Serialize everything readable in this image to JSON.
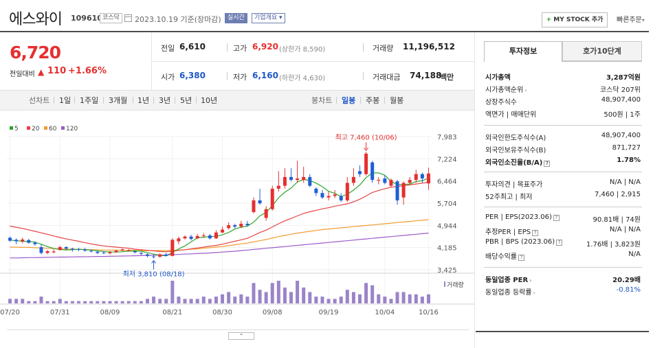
{
  "header": {
    "name": "에스와이",
    "code": "109610",
    "market": "코스닥",
    "date": "2023.10.19 기준(장마감)",
    "realtime_label": "실시간",
    "company_label": "기업개요",
    "mystock_label": "MY STOCK 추가",
    "quick_label": "빠른주문"
  },
  "price": {
    "current": "6,720",
    "diff_label": "전일대비",
    "diff_symbol": "▲",
    "diff_value": "110",
    "diff_rate": "+1.66%"
  },
  "quote": {
    "prev_close_label": "전일",
    "prev_close": "6,610",
    "high_label": "고가",
    "high": "6,920",
    "upper_limit": "(상한가 8,590)",
    "volume_label": "거래량",
    "volume": "11,196,512",
    "open_label": "시가",
    "open": "6,380",
    "low_label": "저가",
    "low": "6,160",
    "lower_limit": "(하한가 4,630)",
    "amount_label": "거래대금",
    "amount": "74,188",
    "amount_unit": "백만"
  },
  "period_bar": {
    "label": "선차트",
    "periods": [
      "1일",
      "1주일",
      "3개월",
      "1년",
      "3년",
      "5년",
      "10년"
    ],
    "candle_label": "봉차트",
    "candles": [
      "일봉",
      "주봉",
      "월봉"
    ],
    "active_candle": "일봉"
  },
  "chart_data": {
    "type": "candlestick",
    "legend": [
      "5",
      "20",
      "60",
      "120"
    ],
    "legend_colors": [
      "#2ea52e",
      "#e84040",
      "#f29b2f",
      "#9b5bc9"
    ],
    "price_ticks": [
      "7,983",
      "7,224",
      "6,464",
      "5,704",
      "4,944",
      "4,185",
      "3,425"
    ],
    "price_range": [
      3425,
      7983
    ],
    "x_labels": [
      "07/20",
      "07/31",
      "08/09",
      "08/21",
      "08/30",
      "09/08",
      "09/19",
      "10/04",
      "10/16"
    ],
    "volume_label": "거래량",
    "max_annotation": "최고 7,460 (10/06)",
    "min_annotation": "최저 3,810 (08/18)",
    "candles": [
      {
        "o": 4520,
        "c": 4420,
        "h": 4560,
        "l": 4380
      },
      {
        "o": 4450,
        "c": 4400,
        "h": 4500,
        "l": 4300
      },
      {
        "o": 4400,
        "c": 4460,
        "h": 4520,
        "l": 4330
      },
      {
        "o": 4440,
        "c": 4350,
        "h": 4480,
        "l": 4320
      },
      {
        "o": 4350,
        "c": 4300,
        "h": 4400,
        "l": 4250
      },
      {
        "o": 4200,
        "c": 4000,
        "h": 4300,
        "l": 3950
      },
      {
        "o": 4000,
        "c": 4060,
        "h": 4100,
        "l": 3960
      },
      {
        "o": 4020,
        "c": 4050,
        "h": 4120,
        "l": 3990
      },
      {
        "o": 4100,
        "c": 4200,
        "h": 4250,
        "l": 4080
      },
      {
        "o": 4200,
        "c": 4150,
        "h": 4230,
        "l": 4100
      },
      {
        "o": 4150,
        "c": 4120,
        "h": 4180,
        "l": 4050
      },
      {
        "o": 4130,
        "c": 4110,
        "h": 4170,
        "l": 4060
      },
      {
        "o": 4120,
        "c": 4080,
        "h": 4170,
        "l": 4040
      },
      {
        "o": 4070,
        "c": 4050,
        "h": 4120,
        "l": 4020
      },
      {
        "o": 4040,
        "c": 4000,
        "h": 4080,
        "l": 3960
      },
      {
        "o": 4010,
        "c": 3990,
        "h": 4050,
        "l": 3960
      },
      {
        "o": 3990,
        "c": 4030,
        "h": 4070,
        "l": 3950
      },
      {
        "o": 4030,
        "c": 4080,
        "h": 4110,
        "l": 4000
      },
      {
        "o": 4080,
        "c": 4120,
        "h": 4150,
        "l": 4060
      },
      {
        "o": 4090,
        "c": 4100,
        "h": 4130,
        "l": 4050
      },
      {
        "o": 4060,
        "c": 4020,
        "h": 4080,
        "l": 3990
      },
      {
        "o": 4000,
        "c": 3970,
        "h": 4030,
        "l": 3930
      },
      {
        "o": 3950,
        "c": 3900,
        "h": 3990,
        "l": 3850
      },
      {
        "o": 3880,
        "c": 3870,
        "h": 3940,
        "l": 3810
      },
      {
        "o": 3870,
        "c": 3950,
        "h": 3990,
        "l": 3840
      },
      {
        "o": 3950,
        "c": 3900,
        "h": 4000,
        "l": 3880
      },
      {
        "o": 3900,
        "c": 4450,
        "h": 4500,
        "l": 3880
      },
      {
        "o": 4400,
        "c": 4500,
        "h": 4560,
        "l": 4300
      },
      {
        "o": 4500,
        "c": 4560,
        "h": 4600,
        "l": 4460
      },
      {
        "o": 4560,
        "c": 4480,
        "h": 4620,
        "l": 4430
      },
      {
        "o": 4500,
        "c": 4580,
        "h": 4650,
        "l": 4470
      },
      {
        "o": 4580,
        "c": 4600,
        "h": 4680,
        "l": 4520
      },
      {
        "o": 4600,
        "c": 4500,
        "h": 4650,
        "l": 4460
      },
      {
        "o": 4500,
        "c": 4700,
        "h": 4780,
        "l": 4480
      },
      {
        "o": 4700,
        "c": 4800,
        "h": 4900,
        "l": 4680
      },
      {
        "o": 4850,
        "c": 4950,
        "h": 5050,
        "l": 4800
      },
      {
        "o": 4950,
        "c": 4900,
        "h": 5000,
        "l": 4850
      },
      {
        "o": 4900,
        "c": 5000,
        "h": 5100,
        "l": 4850
      },
      {
        "o": 5000,
        "c": 4950,
        "h": 5100,
        "l": 4900
      },
      {
        "o": 5400,
        "c": 5800,
        "h": 5900,
        "l": 5350
      },
      {
        "o": 5800,
        "c": 5700,
        "h": 6200,
        "l": 5650
      },
      {
        "o": 5200,
        "c": 5500,
        "h": 5600,
        "l": 5100
      },
      {
        "o": 5500,
        "c": 6200,
        "h": 6300,
        "l": 5450
      },
      {
        "o": 6200,
        "c": 6300,
        "h": 6800,
        "l": 6100
      },
      {
        "o": 6300,
        "c": 6600,
        "h": 6900,
        "l": 6200
      },
      {
        "o": 6600,
        "c": 6500,
        "h": 6900,
        "l": 6450
      },
      {
        "o": 6500,
        "c": 6550,
        "h": 7160,
        "l": 6400
      },
      {
        "o": 6500,
        "c": 6600,
        "h": 6950,
        "l": 6400
      },
      {
        "o": 6600,
        "c": 6300,
        "h": 6700,
        "l": 6250
      },
      {
        "o": 6200,
        "c": 6050,
        "h": 6250,
        "l": 5950
      },
      {
        "o": 6050,
        "c": 5900,
        "h": 6150,
        "l": 5850
      },
      {
        "o": 5900,
        "c": 5950,
        "h": 6100,
        "l": 5800
      },
      {
        "o": 5950,
        "c": 6000,
        "h": 6150,
        "l": 5880
      },
      {
        "o": 5950,
        "c": 5800,
        "h": 6050,
        "l": 5750
      },
      {
        "o": 5800,
        "c": 6400,
        "h": 6600,
        "l": 5750
      },
      {
        "o": 6400,
        "c": 6600,
        "h": 6900,
        "l": 6300
      },
      {
        "o": 6800,
        "c": 6700,
        "h": 7000,
        "l": 6600
      },
      {
        "o": 6700,
        "c": 7400,
        "h": 7460,
        "l": 6650
      },
      {
        "o": 7100,
        "c": 6500,
        "h": 7150,
        "l": 6400
      },
      {
        "o": 6500,
        "c": 6500,
        "h": 6600,
        "l": 6350
      },
      {
        "o": 6550,
        "c": 6400,
        "h": 6650,
        "l": 6350
      },
      {
        "o": 6300,
        "c": 6500,
        "h": 6550,
        "l": 6250
      },
      {
        "o": 6450,
        "c": 5800,
        "h": 6500,
        "l": 5650
      },
      {
        "o": 5900,
        "c": 6400,
        "h": 6450,
        "l": 5650
      },
      {
        "o": 6400,
        "c": 6500,
        "h": 6600,
        "l": 6350
      },
      {
        "o": 6500,
        "c": 6700,
        "h": 6850,
        "l": 6400
      },
      {
        "o": 6700,
        "c": 6550,
        "h": 6750,
        "l": 6400
      },
      {
        "o": 6380,
        "c": 6720,
        "h": 6920,
        "l": 6160
      }
    ],
    "volumes": [
      2,
      2,
      2,
      1,
      1,
      3,
      1,
      1,
      2,
      1,
      1,
      1,
      1,
      1,
      1,
      1,
      1,
      1,
      1,
      1,
      1,
      1,
      2,
      3,
      2,
      2,
      10,
      3,
      2,
      2,
      2,
      3,
      2,
      3,
      4,
      5,
      3,
      4,
      3,
      9,
      6,
      5,
      9,
      10,
      7,
      5,
      10,
      7,
      5,
      3,
      3,
      2,
      2,
      3,
      6,
      5,
      4,
      9,
      8,
      4,
      3,
      2,
      5,
      5,
      4,
      4,
      3,
      4
    ],
    "ma5": [
      4440,
      4420,
      4400,
      4390,
      4370,
      4300,
      4220,
      4150,
      4120,
      4100,
      4110,
      4130,
      4110,
      4100,
      4070,
      4050,
      4030,
      4030,
      4040,
      4060,
      4070,
      4060,
      4010,
      3960,
      3920,
      3900,
      4020,
      4140,
      4240,
      4380,
      4520,
      4540,
      4560,
      4570,
      4620,
      4700,
      4820,
      4880,
      4920,
      5050,
      5270,
      5390,
      5620,
      5890,
      6080,
      6220,
      6430,
      6520,
      6480,
      6390,
      6270,
      6110,
      6040,
      5930,
      6010,
      6150,
      6330,
      6580,
      6740,
      6740,
      6660,
      6450,
      6340,
      6340,
      6360,
      6440,
      6480,
      6560
    ],
    "ma20": [
      4920,
      4880,
      4840,
      4790,
      4740,
      4690,
      4640,
      4580,
      4530,
      4480,
      4440,
      4400,
      4350,
      4310,
      4270,
      4240,
      4220,
      4200,
      4180,
      4160,
      4130,
      4110,
      4090,
      4070,
      4050,
      4040,
      4060,
      4090,
      4110,
      4140,
      4170,
      4200,
      4230,
      4260,
      4300,
      4350,
      4400,
      4450,
      4500,
      4600,
      4700,
      4780,
      4890,
      5000,
      5100,
      5180,
      5270,
      5350,
      5410,
      5460,
      5510,
      5550,
      5600,
      5640,
      5680,
      5750,
      5840,
      5950,
      6070,
      6140,
      6200,
      6250,
      6280,
      6300,
      6330,
      6360,
      6390,
      6420
    ],
    "ma60": [
      4200,
      4200,
      4190,
      4190,
      4180,
      4170,
      4160,
      4150,
      4140,
      4130,
      4130,
      4120,
      4120,
      4110,
      4110,
      4100,
      4100,
      4100,
      4090,
      4090,
      4090,
      4080,
      4080,
      4080,
      4080,
      4080,
      4090,
      4100,
      4110,
      4130,
      4140,
      4160,
      4180,
      4200,
      4220,
      4250,
      4280,
      4310,
      4340,
      4380,
      4420,
      4460,
      4510,
      4560,
      4600,
      4640,
      4680,
      4710,
      4740,
      4770,
      4800,
      4820,
      4840,
      4860,
      4880,
      4900,
      4920,
      4940,
      4960,
      4980,
      5000,
      5020,
      5040,
      5060,
      5080,
      5100,
      5120,
      5140
    ],
    "ma120": [
      3830,
      3830,
      3835,
      3840,
      3840,
      3845,
      3850,
      3855,
      3860,
      3860,
      3865,
      3870,
      3870,
      3875,
      3880,
      3880,
      3885,
      3890,
      3895,
      3900,
      3905,
      3910,
      3915,
      3920,
      3925,
      3930,
      3940,
      3950,
      3960,
      3970,
      3980,
      3990,
      4000,
      4015,
      4030,
      4045,
      4060,
      4080,
      4100,
      4120,
      4140,
      4160,
      4180,
      4200,
      4220,
      4240,
      4260,
      4280,
      4300,
      4320,
      4340,
      4360,
      4380,
      4400,
      4420,
      4440,
      4460,
      4480,
      4500,
      4520,
      4540,
      4560,
      4580,
      4600,
      4620,
      4640,
      4660,
      4680
    ]
  },
  "invest_panel": {
    "tab_invest": "투자정보",
    "tab_hoga": "호가10단계",
    "rows": [
      {
        "k": "시가총액",
        "v": "3,287억원",
        "bold": true
      },
      {
        "k": "시가총액순위",
        "v": "코스닥 207위",
        "arrow": true
      },
      {
        "k": "상장주식수",
        "v": "48,907,400"
      },
      {
        "k": "액면가 | 매매단위",
        "v": "500원 | 1주"
      },
      {
        "k": "외국인한도주식수(A)",
        "v": "48,907,400"
      },
      {
        "k": "외국인보유주식수(B)",
        "v": "871,727"
      },
      {
        "k": "외국인소진율(B/A)",
        "v": "1.78%",
        "bold": true,
        "q": true
      },
      {
        "k": "투자의견 | 목표주가",
        "v": "N/A | N/A"
      },
      {
        "k": "52주최고 | 최저",
        "v": "7,460 | 2,915"
      },
      {
        "k": "PER | EPS(2023.06)",
        "v": "90.81배 | 74원",
        "q": true
      },
      {
        "k": "추정PER | EPS",
        "v": "N/A | N/A",
        "q": true
      },
      {
        "k": "PBR | BPS (2023.06)",
        "v": "1.76배 | 3,823원",
        "q": true
      },
      {
        "k": "배당수익률",
        "v": "N/A",
        "q": true
      },
      {
        "k": "동일업종 PER",
        "v": "20.29배",
        "bold": true,
        "arrow": true
      },
      {
        "k": "동일업종 등락률",
        "v": "-0.81%",
        "arrow": true,
        "blue": true
      }
    ]
  }
}
